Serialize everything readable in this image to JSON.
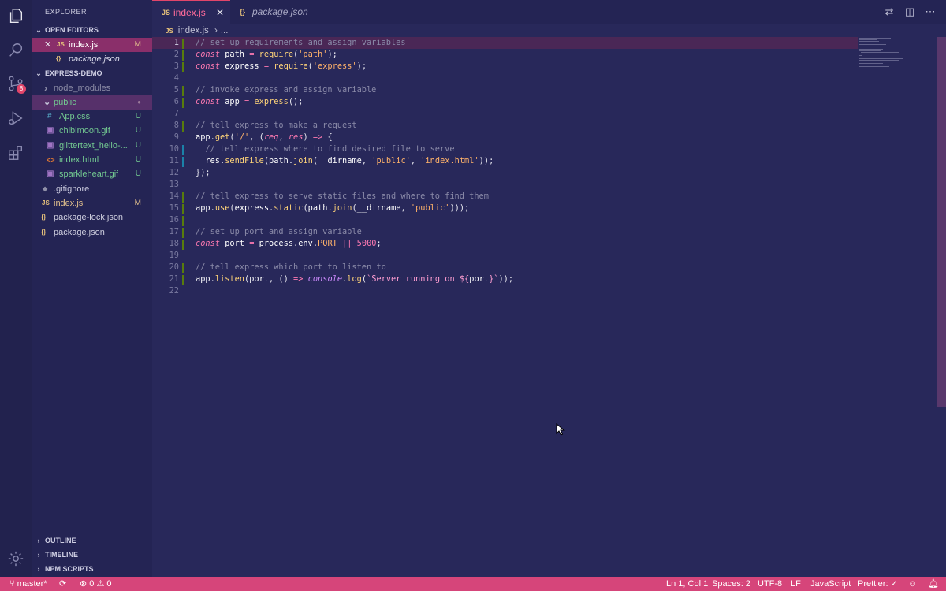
{
  "sidebar": {
    "title": "EXPLORER",
    "open_editors": {
      "label": "OPEN EDITORS",
      "items": [
        {
          "close": "✕",
          "icon": "JS",
          "name": "index.js",
          "status": "M"
        },
        {
          "icon": "{}",
          "name": "package.json",
          "status": ""
        }
      ]
    },
    "project": {
      "label": "EXPRESS-DEMO",
      "items": [
        {
          "icon": "›",
          "name": "node_modules",
          "status": ""
        },
        {
          "icon": "⌄",
          "name": "public",
          "status": "●"
        },
        {
          "icon": "#",
          "name": "App.css",
          "status": "U"
        },
        {
          "icon": "▣",
          "name": "chibimoon.gif",
          "status": "U"
        },
        {
          "icon": "▣",
          "name": "glittertext_hello-...",
          "status": "U"
        },
        {
          "icon": "<>",
          "name": "index.html",
          "status": "U"
        },
        {
          "icon": "▣",
          "name": "sparkleheart.gif",
          "status": "U"
        },
        {
          "icon": "◆",
          "name": ".gitignore",
          "status": ""
        },
        {
          "icon": "JS",
          "name": "index.js",
          "status": "M"
        },
        {
          "icon": "{}",
          "name": "package-lock.json",
          "status": ""
        },
        {
          "icon": "{}",
          "name": "package.json",
          "status": ""
        }
      ]
    },
    "bottom_sections": [
      "OUTLINE",
      "TIMELINE",
      "NPM SCRIPTS"
    ]
  },
  "activity": {
    "icons": [
      "files-icon",
      "search-icon",
      "source-control-icon",
      "run-debug-icon",
      "extensions-icon",
      "gear-icon"
    ],
    "scm_badge": "8"
  },
  "tabs": [
    {
      "icon": "JS",
      "label": "index.js",
      "close": "✕"
    },
    {
      "icon": "{}",
      "label": "package.json"
    }
  ],
  "breadcrumb": {
    "icon": "JS",
    "file": "index.js",
    "sep": "›",
    "rest": "..."
  },
  "code": {
    "line_numbers": [
      "1",
      "2",
      "3",
      "4",
      "5",
      "6",
      "7",
      "8",
      "9",
      "10",
      "11",
      "12",
      "13",
      "14",
      "15",
      "16",
      "17",
      "18",
      "19",
      "20",
      "21",
      "22"
    ]
  },
  "statusbar": {
    "branch": "master*",
    "errors": "0",
    "warnings": "0",
    "position": "Ln 1, Col 1",
    "spaces": "Spaces: 2",
    "encoding": "UTF-8",
    "eol": "LF",
    "language": "JavaScript",
    "prettier": "Prettier: ✓"
  },
  "colors": {
    "accent": "#d6457a",
    "editor_bg": "#28285a",
    "sidebar_bg": "#242454"
  }
}
